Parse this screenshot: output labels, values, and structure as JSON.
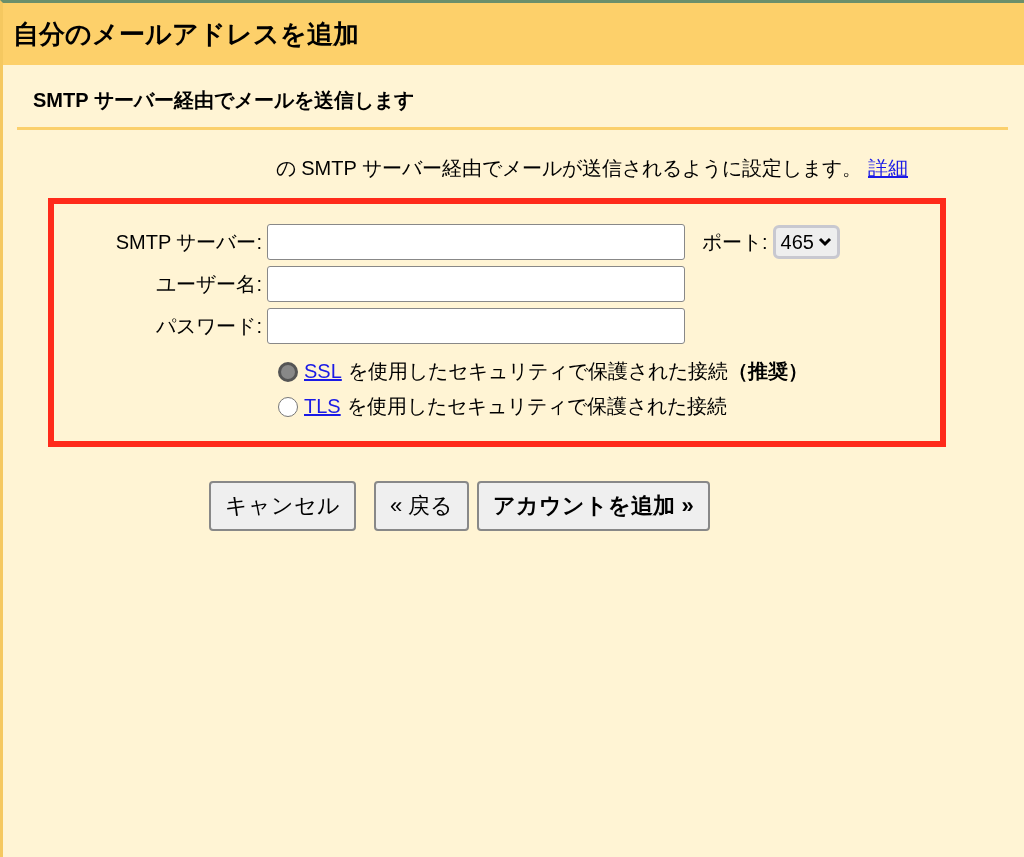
{
  "window": {
    "title": "自分のメールアドレスを追加"
  },
  "section": {
    "heading": "SMTP サーバー経由でメールを送信します",
    "description": "の SMTP サーバー経由でメールが送信されるように設定します。",
    "details_link": "詳細"
  },
  "fields": [
    {
      "label": "SMTP サーバー:"
    },
    {
      "label": "ユーザー名:"
    },
    {
      "label": "パスワード:"
    }
  ],
  "port": {
    "label": "ポート:",
    "value": "465"
  },
  "security_options": [
    {
      "link": "SSL",
      "label": "を使用したセキュリティで保護された接続**（推奨）**",
      "selected": true
    },
    {
      "link": "TLS",
      "label": "を使用したセキュリティで保護された接続",
      "selected": false
    }
  ],
  "buttons": [
    {
      "label": "キャンセル",
      "kind": "cancel"
    },
    {
      "label": "« 戻る",
      "kind": "back"
    },
    {
      "label": "アカウントを追加 »",
      "kind": "submit"
    }
  ]
}
